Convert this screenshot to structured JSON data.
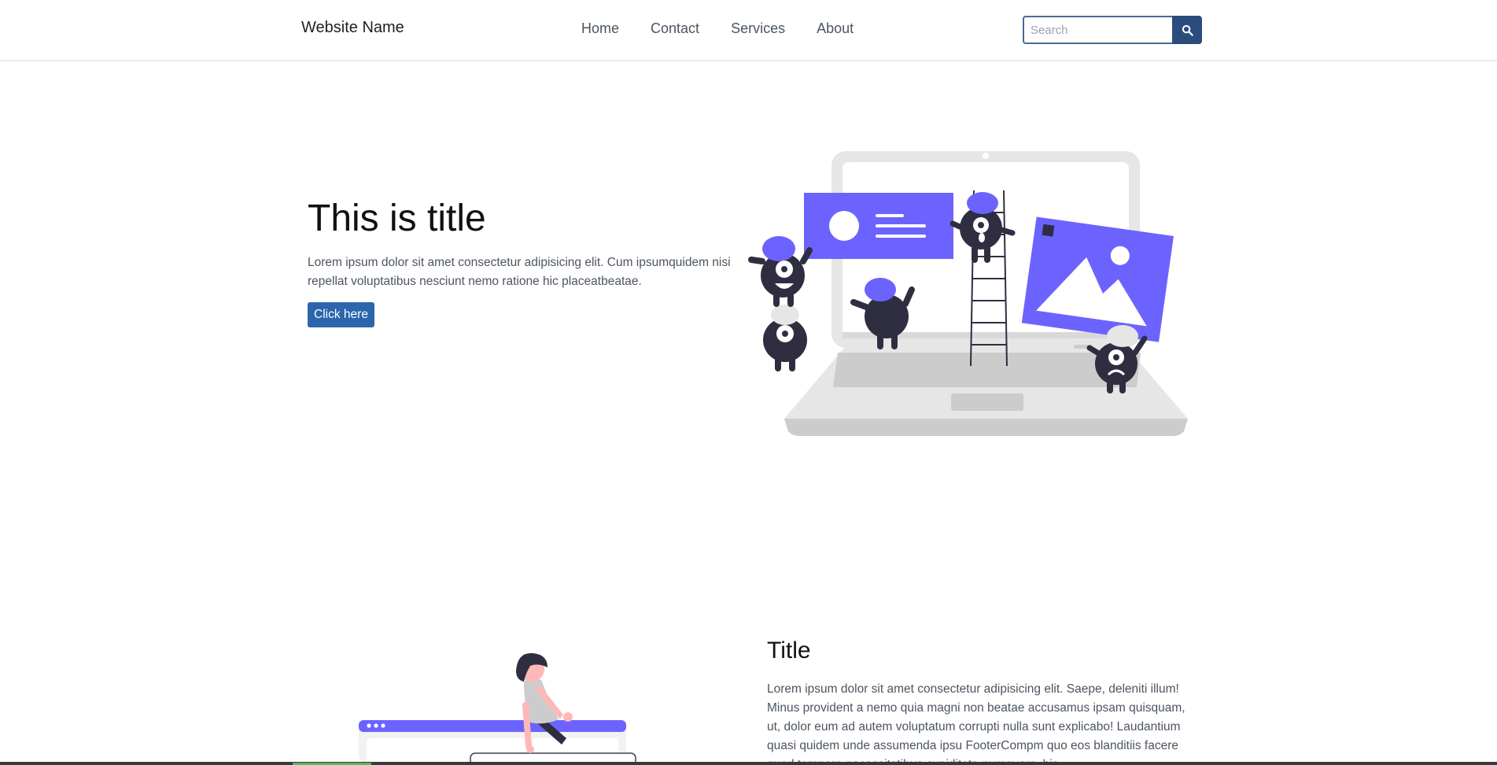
{
  "navbar": {
    "brand": "Website Name",
    "links": [
      {
        "label": "Home"
      },
      {
        "label": "Contact"
      },
      {
        "label": "Services"
      },
      {
        "label": "About"
      }
    ],
    "search": {
      "placeholder": "Search",
      "icon": "search-icon"
    }
  },
  "hero": {
    "title": "This is title",
    "text": "Lorem ipsum dolor sit amet consectetur adipisicing elit. Cum ipsumquidem nisi repellat voluptatibus nesciunt nemo ratione hic placeatbeatae.",
    "button_label": "Click here"
  },
  "section": {
    "title": "Title",
    "text": "Lorem ipsum dolor sit amet consectetur adipisicing elit. Saepe, deleniti illum! Minus provident a nemo quia magni non beatae accusamus ipsam quisquam, ut, dolor eum ad autem voluptatum corrupti nulla sunt explicabo! Laudantium quasi quidem unde assumenda ipsu FooterCompm quo eos blanditiis facere quod tempora necessitatibus cupiditate numquam, hic"
  },
  "colors": {
    "accent": "#6c63ff",
    "dark": "#2f2e41",
    "button": "#2b66ad",
    "search_button": "#2b4d7d"
  }
}
